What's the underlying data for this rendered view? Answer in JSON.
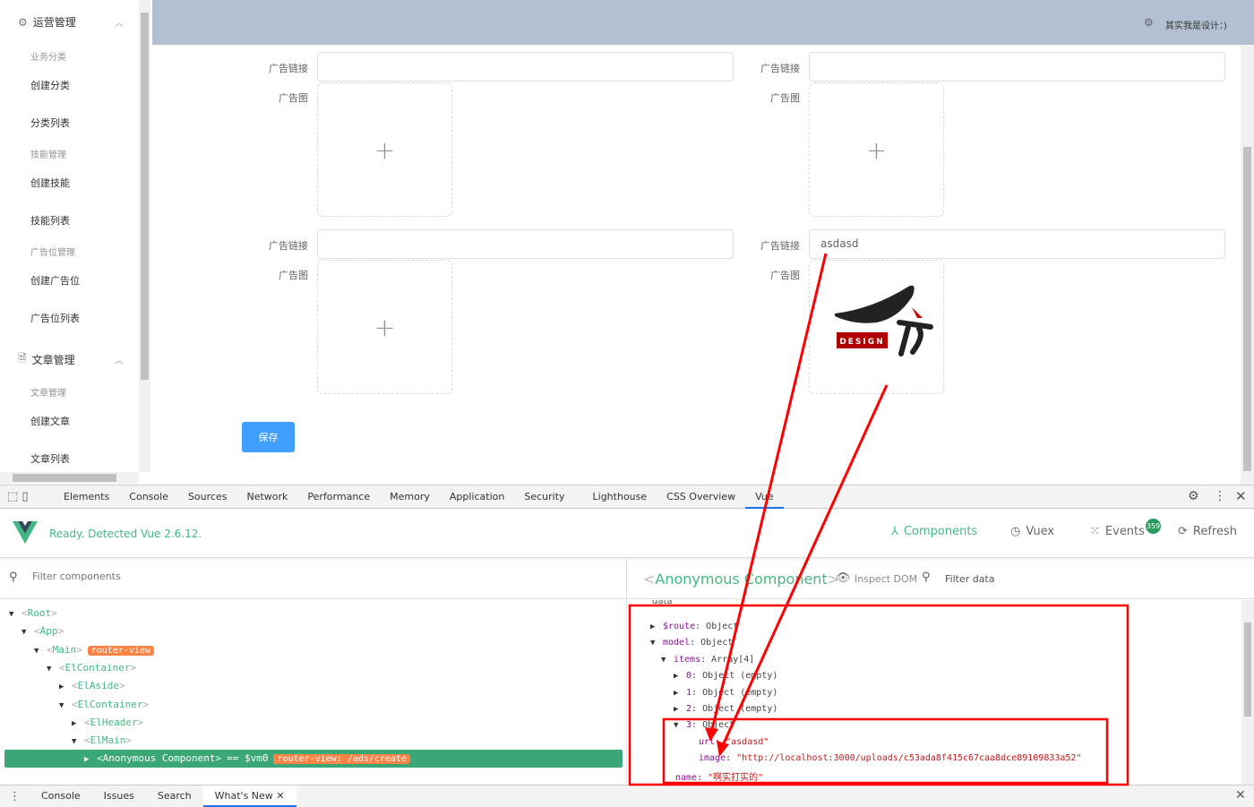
{
  "sidebar": {
    "groups": [
      {
        "label": "运营管理",
        "icon": "gear-icon"
      },
      {
        "label": "文章管理",
        "icon": "document-icon"
      }
    ],
    "subheads": [
      "业务分类",
      "技能管理",
      "广告位管理",
      "文章管理"
    ],
    "items": [
      "创建分类",
      "分类列表",
      "创建技能",
      "技能列表",
      "创建广告位",
      "广告位列表",
      "创建文章",
      "文章列表"
    ]
  },
  "header": {
    "user_text": "其实我是设计：)"
  },
  "form": {
    "link_label": "广告链接",
    "image_label": "广告图",
    "items": [
      {
        "url": ""
      },
      {
        "url": ""
      },
      {
        "url": ""
      },
      {
        "url": "asdasd",
        "image_alt": "DESIGN"
      }
    ],
    "save_label": "保存"
  },
  "devtools": {
    "tabs": [
      "Elements",
      "Console",
      "Sources",
      "Network",
      "Performance",
      "Memory",
      "Application",
      "Security",
      "Lighthouse",
      "CSS Overview",
      "Vue"
    ],
    "active_tab": "Vue",
    "vue": {
      "status": "Ready. Detected Vue 2.6.12.",
      "nav": {
        "components": "Components",
        "vuex": "Vuex",
        "events": "Events",
        "events_count": "359",
        "refresh": "Refresh"
      },
      "filter_placeholder": "Filter components",
      "selected_component": "Anonymous Component",
      "inspect_dom": "Inspect DOM",
      "filter_data": "Filter data",
      "data_section": "data",
      "tree": [
        {
          "name": "Root",
          "depth": 0,
          "open": true
        },
        {
          "name": "App",
          "depth": 1,
          "open": true
        },
        {
          "name": "Main",
          "depth": 2,
          "open": true,
          "badge": "router-view"
        },
        {
          "name": "ElContainer",
          "depth": 3,
          "open": true
        },
        {
          "name": "ElAside",
          "depth": 4,
          "open": false
        },
        {
          "name": "ElContainer",
          "depth": 4,
          "open": true
        },
        {
          "name": "ElHeader",
          "depth": 5,
          "open": false
        },
        {
          "name": "ElMain",
          "depth": 5,
          "open": true
        },
        {
          "name": "Anonymous Component",
          "depth": 6,
          "open": false,
          "selected": true,
          "suffix": "== $vm0",
          "badge": "router-view: /ads/create"
        }
      ],
      "data": {
        "route": {
          "key": "$route",
          "value": "Object"
        },
        "model": {
          "key": "model",
          "value": "Object"
        },
        "items": {
          "key": "items",
          "value": "Array[4]"
        },
        "entries": [
          {
            "key": "0",
            "value": "Object (empty)"
          },
          {
            "key": "1",
            "value": "Object (empty)"
          },
          {
            "key": "2",
            "value": "Object (empty)"
          },
          {
            "key": "3",
            "value": "Object"
          }
        ],
        "url": {
          "key": "url",
          "value": "\"asdasd\""
        },
        "image": {
          "key": "image",
          "value": "\"http://localhost:3000/uploads/c53ada8f415c67caa8dce89109833a52\""
        },
        "name": {
          "key": "name",
          "value": "\"啊实打实的\""
        }
      }
    },
    "drawer_tabs": [
      "Console",
      "Issues",
      "Search",
      "What's New"
    ]
  },
  "colors": {
    "accent": "#409eff",
    "vue_green": "#42b983",
    "header_bg": "#b3c0d1",
    "annotation": "#ff0000",
    "badge": "#ff8344"
  }
}
